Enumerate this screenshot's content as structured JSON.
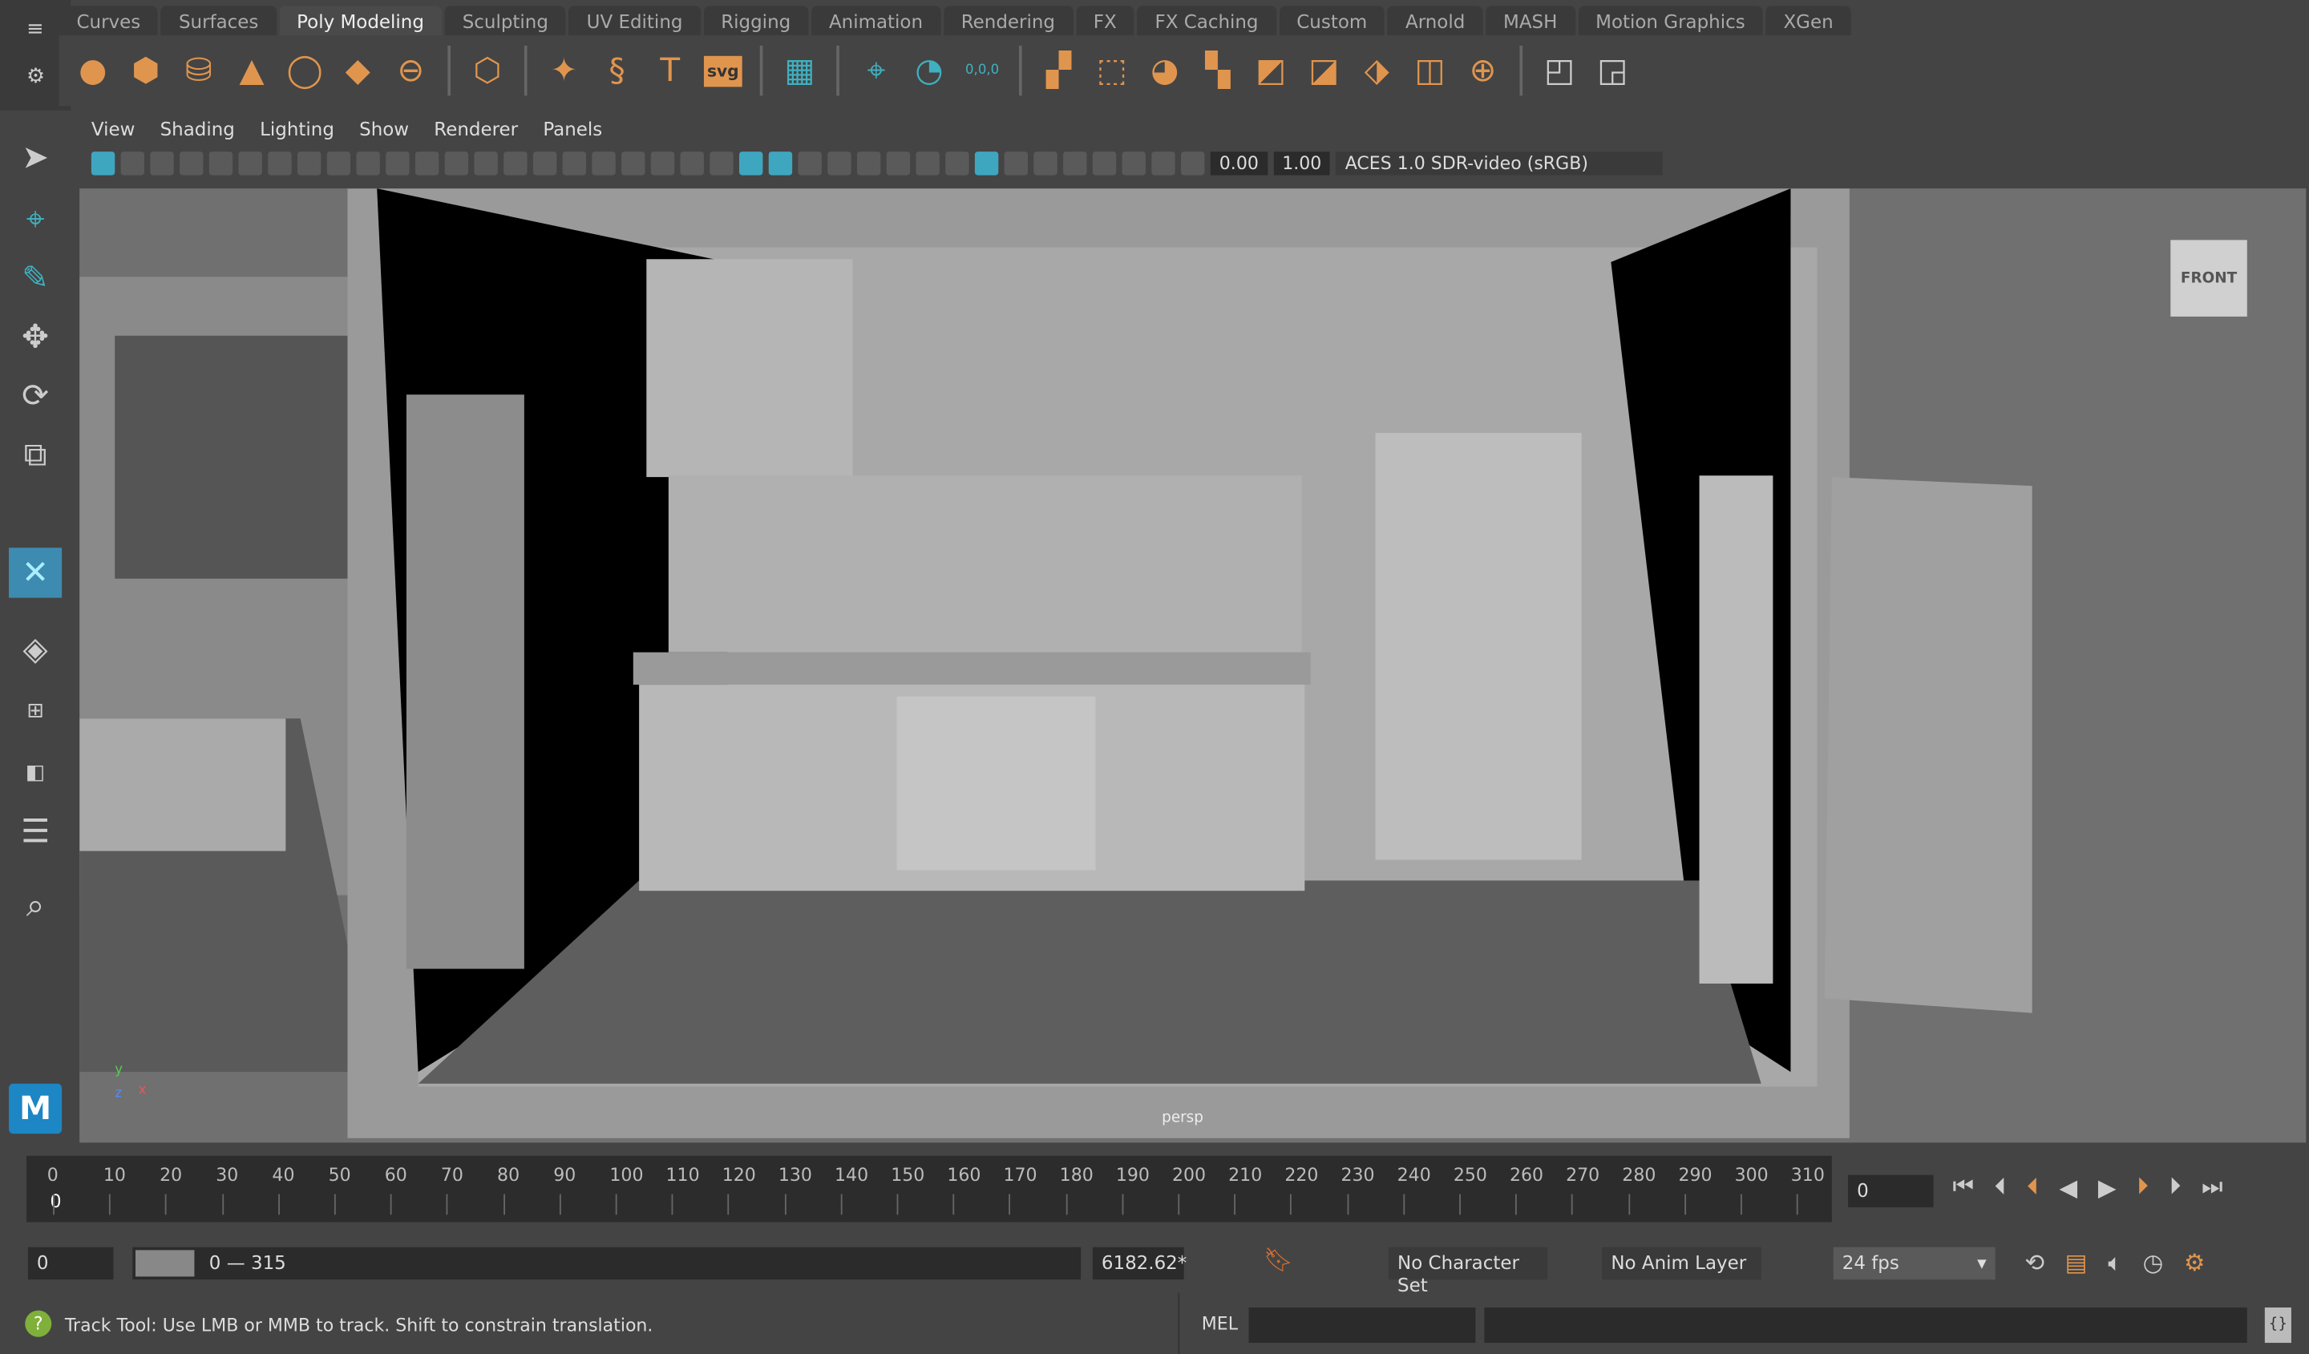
{
  "shelf_tabs": [
    "Curves",
    "Surfaces",
    "Poly Modeling",
    "Sculpting",
    "UV Editing",
    "Rigging",
    "Animation",
    "Rendering",
    "FX",
    "FX Caching",
    "Custom",
    "Arnold",
    "MASH",
    "Motion Graphics",
    "XGen"
  ],
  "active_tab": "Poly Modeling",
  "shelf_icons": [
    "poly-sphere-icon",
    "poly-cube-icon",
    "poly-cylinder-icon",
    "poly-cone-icon",
    "poly-torus-icon",
    "poly-plane-icon",
    "poly-disc-icon",
    "platonic-solid-icon",
    "super-shape-icon",
    "helix-icon",
    "type-icon",
    "svg-icon",
    "sweep-mesh-icon",
    "pivot-icon",
    "freeze-icon",
    "reset-transform-icon",
    "combine-icon",
    "separate-icon",
    "extract-icon",
    "boolean-icon",
    "smooth-icon",
    "mirror-icon",
    "extrude-icon",
    "bridge-icon",
    "bevel-icon",
    "multicut-icon",
    "edit-icon"
  ],
  "svg_label": "svg",
  "coord_label": "0,0,0",
  "panel_menu": [
    "View",
    "Shading",
    "Lighting",
    "Show",
    "Renderer",
    "Panels"
  ],
  "panel_toolbar": {
    "exposure": "0.00",
    "gamma": "1.00",
    "colorspace": "ACES 1.0 SDR-video (sRGB)"
  },
  "viewport": {
    "camera": "persp",
    "view_cube": "FRONT",
    "axis_y": "y",
    "axis_x": "x",
    "axis_z": "z"
  },
  "timeline": {
    "ticks": [
      "0",
      "10",
      "20",
      "30",
      "40",
      "50",
      "60",
      "70",
      "80",
      "90",
      "100",
      "110",
      "120",
      "130",
      "140",
      "150",
      "160",
      "170",
      "180",
      "190",
      "200",
      "210",
      "220",
      "230",
      "240",
      "250",
      "260",
      "270",
      "280",
      "290",
      "300",
      "310"
    ],
    "current_frame_label": "0",
    "current_frame_field": "0"
  },
  "range": {
    "start": "0",
    "range_label": "0 — 315",
    "end": "6182.62*",
    "character_set": "No Character Set",
    "anim_layer": "No Anim Layer",
    "fps": "24 fps"
  },
  "status": {
    "message": "Track Tool: Use LMB or MMB to track. Shift to constrain translation.",
    "mel_label": "MEL"
  },
  "colors": {
    "accent": "#e0954e",
    "highlight": "#3fa6c0",
    "active_tool": "#3d8bb0"
  }
}
